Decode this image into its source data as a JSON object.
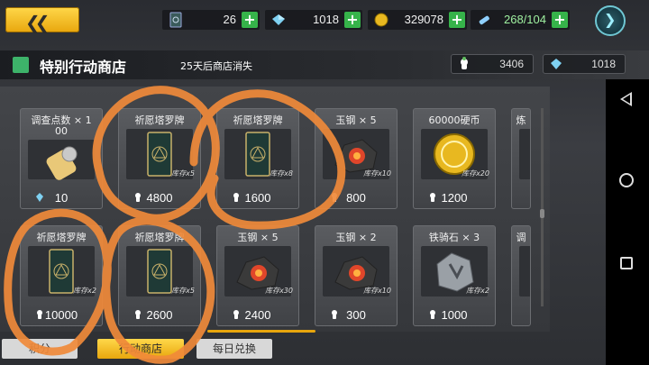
{
  "topbar": {
    "back_icon": "chevron-left-icon",
    "resources": [
      {
        "icon": "card-icon",
        "value": "26"
      },
      {
        "icon": "crystal-icon",
        "value": "1018"
      },
      {
        "icon": "coin-icon",
        "value": "329078"
      },
      {
        "icon": "stamina-icon",
        "value": "268/104"
      }
    ],
    "settings_icon": "chevron-badge-icon"
  },
  "shop": {
    "title": "特别行动商店",
    "expire_text": "25天后商店消失",
    "points": {
      "icon": "ghost-icon",
      "value": "3406"
    },
    "crystals": {
      "icon": "crystal-icon",
      "value": "1018"
    },
    "items": [
      {
        "name": "调查点数 × 1",
        "name2": "00",
        "stock": "",
        "price": "10",
        "icon": "ticket-icon"
      },
      {
        "name": "祈愿塔罗牌",
        "name2": "",
        "stock": "库存x5",
        "price": "4800",
        "icon": "tarot-card-icon"
      },
      {
        "name": "祈愿塔罗牌",
        "name2": "",
        "stock": "库存x8",
        "price": "1600",
        "icon": "tarot-card-icon"
      },
      {
        "name": "玉钢 × 5",
        "name2": "",
        "stock": "库存x10",
        "price": "800",
        "icon": "ore-icon"
      },
      {
        "name": "60000硬币",
        "name2": "",
        "stock": "库存x20",
        "price": "1200",
        "icon": "coin-icon"
      },
      {
        "name": "炼",
        "name2": "",
        "stock": "",
        "price": "",
        "icon": "item-icon"
      },
      {
        "name": "祈愿塔罗牌",
        "name2": "",
        "stock": "库存x2",
        "price": "10000",
        "icon": "tarot-card-icon"
      },
      {
        "name": "祈愿塔罗牌",
        "name2": "",
        "stock": "库存x5",
        "price": "2600",
        "icon": "tarot-card-icon"
      },
      {
        "name": "玉钢 × 5",
        "name2": "",
        "stock": "库存x30",
        "price": "2400",
        "icon": "ore-icon"
      },
      {
        "name": "玉钢 × 2",
        "name2": "",
        "stock": "库存x10",
        "price": "300",
        "icon": "ore-icon"
      },
      {
        "name": "铁骑石 × 3",
        "name2": "",
        "stock": "库存x2",
        "price": "1000",
        "icon": "stone-icon"
      },
      {
        "name": "调",
        "name2": "",
        "stock": "",
        "price": "",
        "icon": "item-icon"
      }
    ]
  },
  "tabs": [
    {
      "label": "积分",
      "active": false
    },
    {
      "label": "行动商店",
      "active": true
    },
    {
      "label": "每日兑换",
      "active": false
    }
  ],
  "android_nav": [
    "back-icon",
    "home-icon",
    "recents-icon"
  ],
  "colors": {
    "accent": "#e8a60d",
    "scribble": "#f08a3a",
    "plus": "#36b34a"
  }
}
